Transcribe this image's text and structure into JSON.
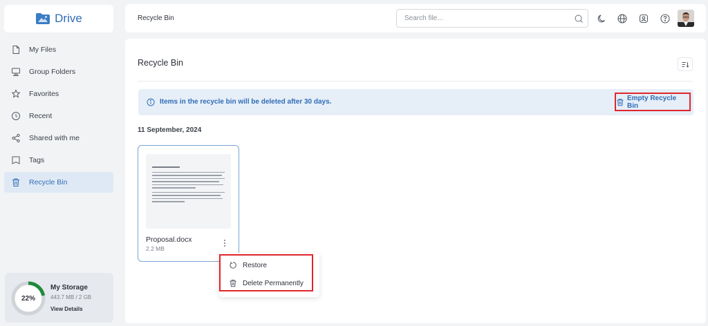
{
  "app": {
    "name": "Drive"
  },
  "sidebar": {
    "items": [
      {
        "label": "My Files",
        "icon": "file-icon"
      },
      {
        "label": "Group Folders",
        "icon": "group-folder-icon"
      },
      {
        "label": "Favorites",
        "icon": "star-icon"
      },
      {
        "label": "Recent",
        "icon": "clock-icon"
      },
      {
        "label": "Shared with me",
        "icon": "share-icon"
      },
      {
        "label": "Tags",
        "icon": "tag-icon"
      },
      {
        "label": "Recycle Bin",
        "icon": "trash-icon",
        "active": true
      }
    ],
    "storage": {
      "title": "My Storage",
      "percent_label": "22%",
      "percent": 0.22,
      "usage": "443.7 MB / 2 GB",
      "link": "View Details"
    }
  },
  "header": {
    "title": "Recycle Bin",
    "search_placeholder": "Search file...",
    "icons": [
      "moon-icon",
      "globe-icon",
      "contact-icon",
      "help-icon"
    ]
  },
  "main": {
    "title": "Recycle Bin",
    "notice": "Items in the recycle bin will be deleted after 30 days.",
    "empty_button": "Empty Recycle Bin",
    "date_group": "11 September, 2024",
    "file": {
      "name": "Proposal.docx",
      "size": "2.2 MB"
    },
    "context_menu": [
      "Restore",
      "Delete Permanently"
    ]
  },
  "colors": {
    "accent": "#2f6db5",
    "highlight": "#e0242b",
    "notice_bg": "#e6eef8"
  }
}
